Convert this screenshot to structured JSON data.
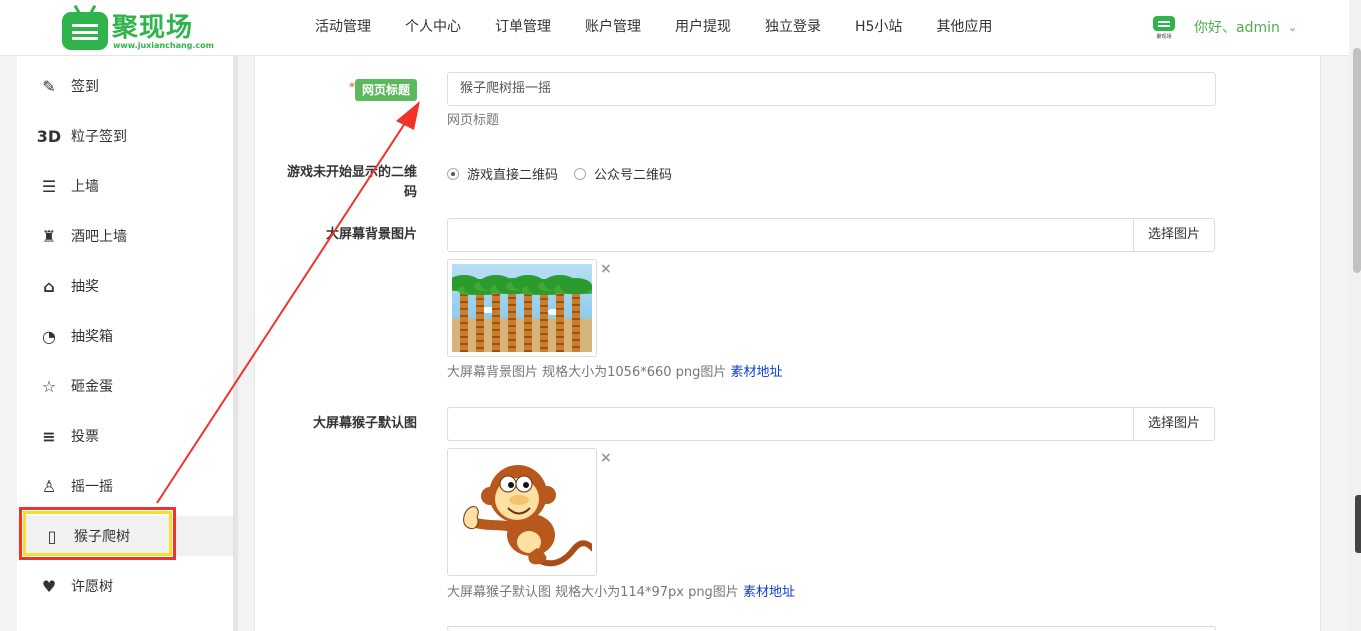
{
  "brand": {
    "title": "聚现场",
    "subtitle": "www.juxianchang.com",
    "mini_logo_text": "聚现场"
  },
  "topnav": [
    "活动管理",
    "个人中心",
    "订单管理",
    "账户管理",
    "用户提现",
    "独立登录",
    "H5小站",
    "其他应用"
  ],
  "user": {
    "greeting": "你好、admin"
  },
  "sidebar": {
    "items": [
      {
        "label": "签到",
        "icon": "edit-icon"
      },
      {
        "label": "粒子签到",
        "icon": "3d-icon",
        "icon_text": "3D"
      },
      {
        "label": "上墙",
        "icon": "message-icon"
      },
      {
        "label": "酒吧上墙",
        "icon": "bar-icon"
      },
      {
        "label": "抽奖",
        "icon": "gift-icon"
      },
      {
        "label": "抽奖箱",
        "icon": "pie-chart-icon"
      },
      {
        "label": "砸金蛋",
        "icon": "star-icon"
      },
      {
        "label": "投票",
        "icon": "list-icon"
      },
      {
        "label": "摇一摇",
        "icon": "shake-icon"
      },
      {
        "label": "猴子爬树",
        "icon": "card-icon",
        "active": true
      },
      {
        "label": "许愿树",
        "icon": "heart-icon"
      }
    ]
  },
  "form": {
    "page_title": {
      "required_mark": "*",
      "label": "网页标题",
      "value": "猴子爬树摇一摇",
      "help": "网页标题"
    },
    "qr_mode": {
      "label": "游戏未开始显示的二维码",
      "options": [
        {
          "label": "游戏直接二维码",
          "checked": true
        },
        {
          "label": "公众号二维码",
          "checked": false
        }
      ]
    },
    "screen_bg": {
      "label": "大屏幕背景图片",
      "button": "选择图片",
      "remove": "×",
      "help": "大屏幕背景图片 规格大小为1056*660 png图片",
      "link": "素材地址"
    },
    "monkey_image": {
      "label": "大屏幕猴子默认图",
      "button": "选择图片",
      "remove": "×",
      "help": "大屏幕猴子默认图 规格大小为114*97px png图片",
      "link": "素材地址"
    }
  },
  "colors": {
    "brand_green": "#2fb44b",
    "annotation_red": "#f0342a",
    "annotation_yellow": "#f6df2f",
    "link_blue": "#0b3ccf"
  }
}
